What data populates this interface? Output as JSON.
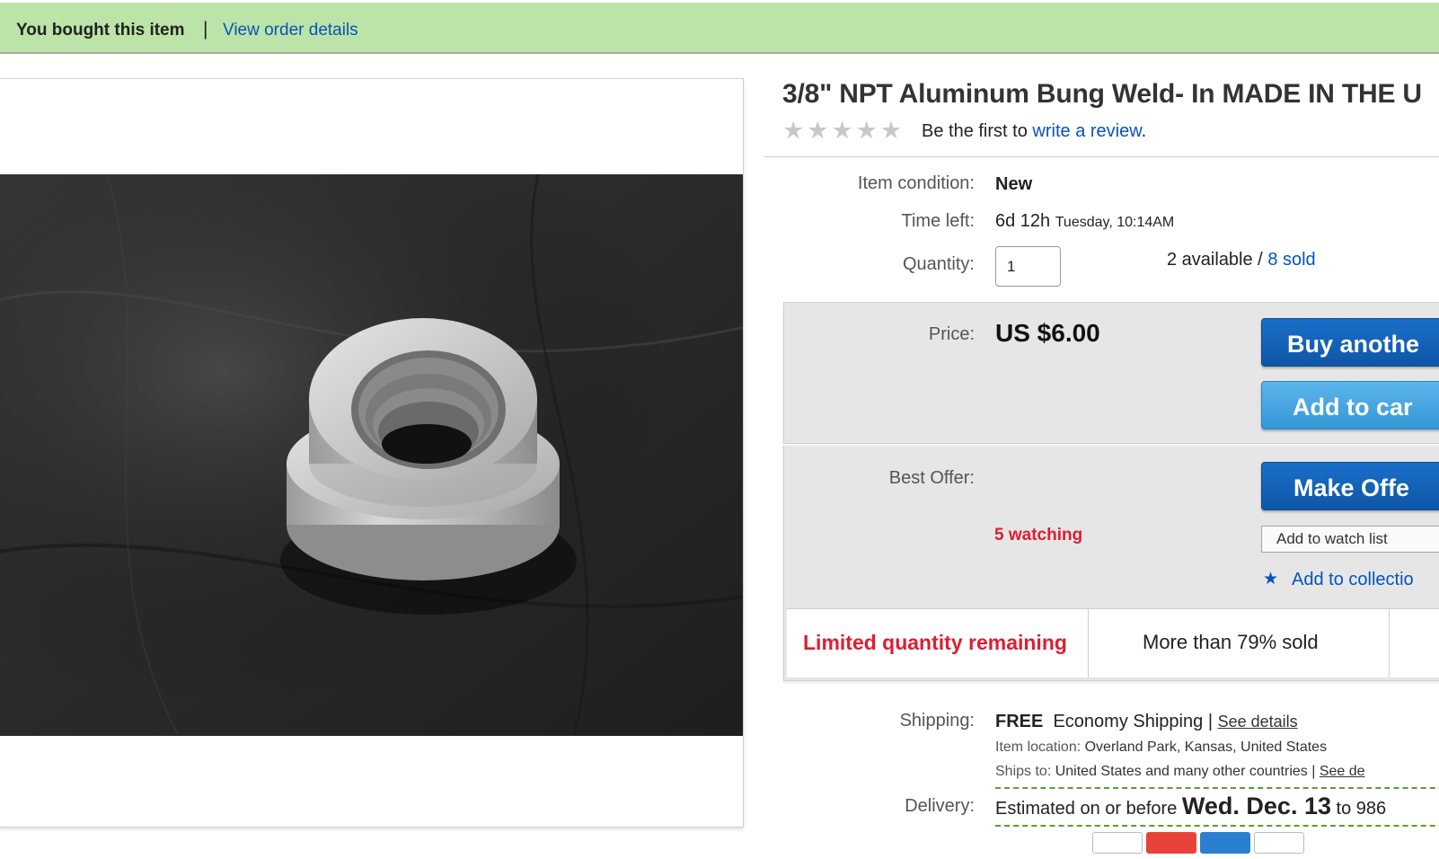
{
  "banner": {
    "bought_text": "You bought this item",
    "separator": "|",
    "order_link": "View order details"
  },
  "product": {
    "title": "3/8\" NPT Aluminum Bung Weld- In MADE IN THE U",
    "rating_stars": 0,
    "review_prefix": "Be the first to",
    "review_link": "write a review",
    "review_suffix": "."
  },
  "details": {
    "condition_label": "Item condition:",
    "condition_value": "New",
    "time_label": "Time left:",
    "time_value": "6d 12h",
    "time_detail": "Tuesday, 10:14AM",
    "quantity_label": "Quantity:",
    "quantity_value": "1",
    "available_text": "2 available /",
    "sold_link": "8 sold"
  },
  "buy_panel": {
    "price_label": "Price:",
    "price_value": "US $6.00",
    "buy_button": "Buy anothe",
    "cart_button": "Add to car",
    "best_offer_label": "Best Offer:",
    "offer_button": "Make Offe",
    "watching": "5 watching",
    "watch_button": "Add to watch list",
    "collection_link": "Add to collectio",
    "limited": "Limited quantity remaining",
    "sold_percent": "More than 79% sold"
  },
  "shipping": {
    "label": "Shipping:",
    "free": "FREE",
    "method": "Economy Shipping",
    "sep": "|",
    "see_details": "See details",
    "location_label": "Item location:",
    "location_value": "Overland Park, Kansas, United States",
    "ships_label": "Ships to:",
    "ships_value": "United States and many other countries",
    "ships_sep": "|",
    "ships_link": "See de"
  },
  "delivery": {
    "label": "Delivery:",
    "prefix": "Estimated on or before",
    "date": "Wed. Dec. 13",
    "suffix": "to 986"
  },
  "colors": {
    "banner_bg": "#bce4a8",
    "link": "#0654ba",
    "alert_red": "#dd1e31",
    "buy_blue": "#0f56a8",
    "cart_blue": "#3596d6"
  }
}
